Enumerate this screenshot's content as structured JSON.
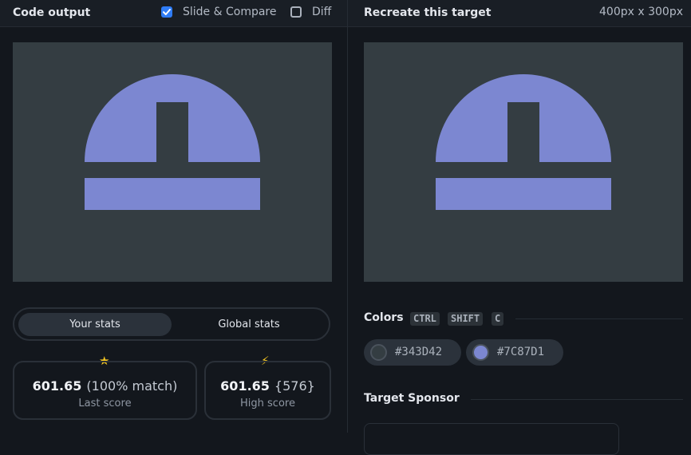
{
  "left_panel": {
    "title": "Code output",
    "slide_compare_label": "Slide & Compare",
    "slide_compare_checked": true,
    "diff_label": "Diff",
    "diff_checked": false
  },
  "right_panel": {
    "title": "Recreate this target",
    "dimensions": "400px x 300px"
  },
  "stats": {
    "tabs": [
      "Your stats",
      "Global stats"
    ],
    "active_tab": "Your stats",
    "last": {
      "icon": "star-icon",
      "glyph": "★",
      "value": "601.65",
      "extra": "(100% match)",
      "caption": "Last score"
    },
    "high": {
      "icon": "lightning-icon",
      "glyph": "⚡",
      "value": "601.65",
      "extra": "{576}",
      "caption": "High score"
    }
  },
  "colors": {
    "title": "Colors",
    "shortcut": [
      "CTRL",
      "SHIFT",
      "C"
    ],
    "swatches": [
      {
        "hex": "#343D42"
      },
      {
        "hex": "#7C87D1"
      }
    ]
  },
  "sponsor": {
    "title": "Target Sponsor"
  },
  "theme": {
    "accent": "#2f7cf6",
    "canvas_bg": "#343d42",
    "shape_color": "#7c87d1"
  }
}
